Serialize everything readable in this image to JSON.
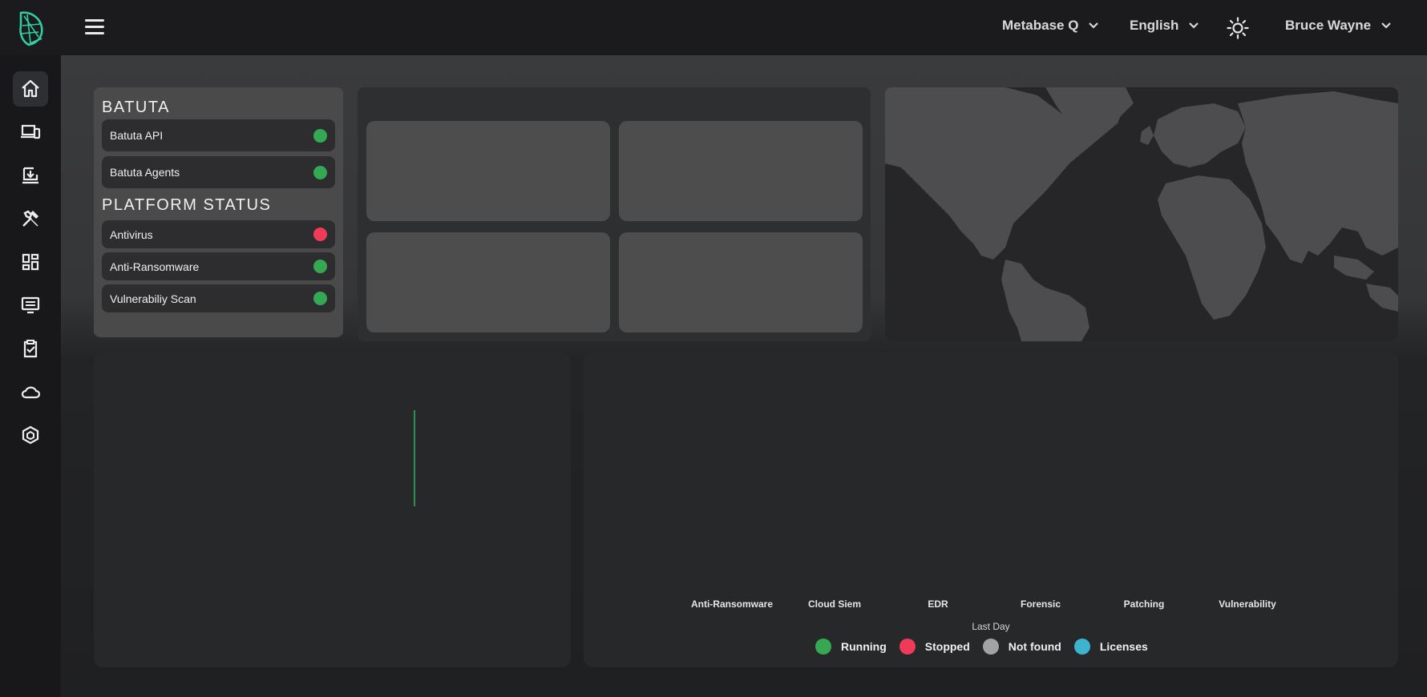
{
  "header": {
    "workspace_label": "Metabase Q",
    "language_label": "English",
    "user_label": "Bruce Wayne"
  },
  "sidebar": {
    "items": [
      {
        "icon": "home-icon"
      },
      {
        "icon": "devices-icon"
      },
      {
        "icon": "download-icon"
      },
      {
        "icon": "tools-icon"
      },
      {
        "icon": "dashboard-icon"
      },
      {
        "icon": "monitor-icon"
      },
      {
        "icon": "clipboard-check-icon"
      },
      {
        "icon": "cloud-icon"
      },
      {
        "icon": "cube-icon"
      }
    ]
  },
  "batuta": {
    "title": "BATUTA",
    "items": [
      {
        "label": "Batuta API",
        "status": "running"
      },
      {
        "label": "Batuta Agents",
        "status": "running"
      }
    ]
  },
  "platform_status": {
    "title": "PLATFORM STATUS",
    "items": [
      {
        "label": "Antivirus",
        "status": "stopped"
      },
      {
        "label": "Anti-Ransomware",
        "status": "running"
      },
      {
        "label": "Vulnerabiliy Scan",
        "status": "running"
      }
    ]
  },
  "chart": {
    "categories": [
      "Anti-Ransomware",
      "Cloud Siem",
      "EDR",
      "Forensic",
      "Patching",
      "Vulnerability"
    ],
    "period_label": "Last Day",
    "legend": [
      {
        "label": "Running",
        "color": "#35a853"
      },
      {
        "label": "Stopped",
        "color": "#ef3b57"
      },
      {
        "label": "Not found",
        "color": "#a3a3a3"
      },
      {
        "label": "Licenses",
        "color": "#3db3cf"
      }
    ]
  },
  "colors": {
    "running": "#35a853",
    "stopped": "#ef3b57",
    "accent": "#2fd1a4"
  }
}
